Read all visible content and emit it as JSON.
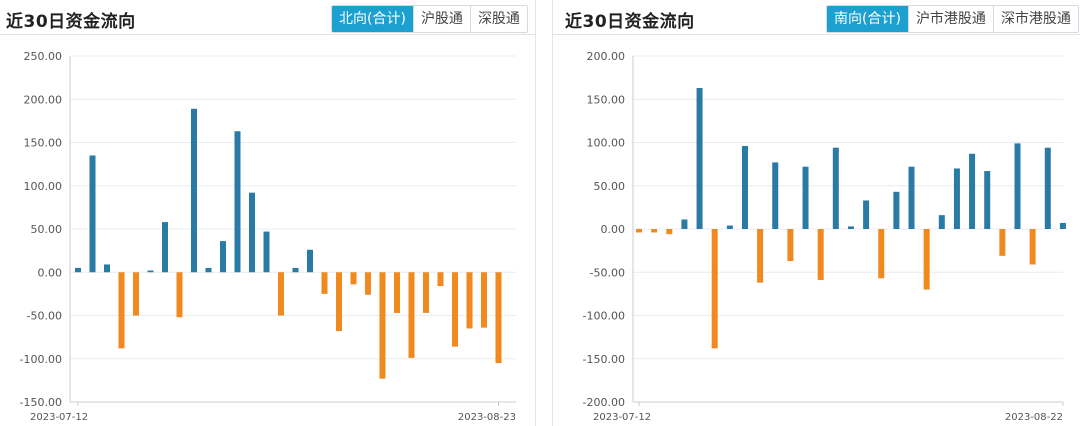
{
  "colors": {
    "positive_bar": "#2a7aa6",
    "negative_bar": "#f0891e",
    "tab_active_bg": "#1ba0d0",
    "grid": "#e9ecef",
    "axis": "#c8ccd0"
  },
  "panels": [
    {
      "title": "近30日资金流向",
      "tabs": [
        {
          "label": "北向(合计)",
          "active": true
        },
        {
          "label": "沪股通",
          "active": false
        },
        {
          "label": "深股通",
          "active": false
        }
      ]
    },
    {
      "title": "近30日资金流向",
      "tabs": [
        {
          "label": "南向(合计)",
          "active": true
        },
        {
          "label": "沪市港股通",
          "active": false
        },
        {
          "label": "深市港股通",
          "active": false
        }
      ]
    }
  ],
  "chart_data": [
    {
      "type": "bar",
      "title": "",
      "xlabel": "",
      "ylabel": "",
      "ylim": [
        -150,
        250
      ],
      "yticks": [
        "250.00",
        "200.00",
        "150.00",
        "100.00",
        "50.00",
        "0.00",
        "-50.00",
        "-100.00",
        "-150.00"
      ],
      "x_start_label": "2023-07-12",
      "x_end_label": "2023-08-23",
      "grid": true,
      "legend": "none",
      "values": [
        5,
        135,
        9,
        -88,
        -50,
        2,
        58,
        -52,
        189,
        5,
        36,
        163,
        92,
        47,
        -50,
        5,
        26,
        -25,
        -68,
        -14,
        -26,
        -123,
        -47,
        -99,
        -47,
        -16,
        -86,
        -65,
        -64,
        -105
      ]
    },
    {
      "type": "bar",
      "title": "",
      "xlabel": "",
      "ylabel": "",
      "ylim": [
        -200,
        200
      ],
      "yticks": [
        "200.00",
        "150.00",
        "100.00",
        "50.00",
        "0.00",
        "-50.00",
        "-100.00",
        "-150.00",
        "-200.00"
      ],
      "x_start_label": "2023-07-12",
      "x_end_label": "2023-08-22",
      "grid": true,
      "legend": "none",
      "values": [
        -4,
        -4,
        -6,
        11,
        163,
        -138,
        4,
        96,
        -62,
        77,
        -37,
        72,
        -59,
        94,
        3,
        33,
        -57,
        43,
        72,
        -70,
        16,
        70,
        87,
        67,
        -31,
        99,
        -41,
        94,
        7
      ]
    }
  ]
}
